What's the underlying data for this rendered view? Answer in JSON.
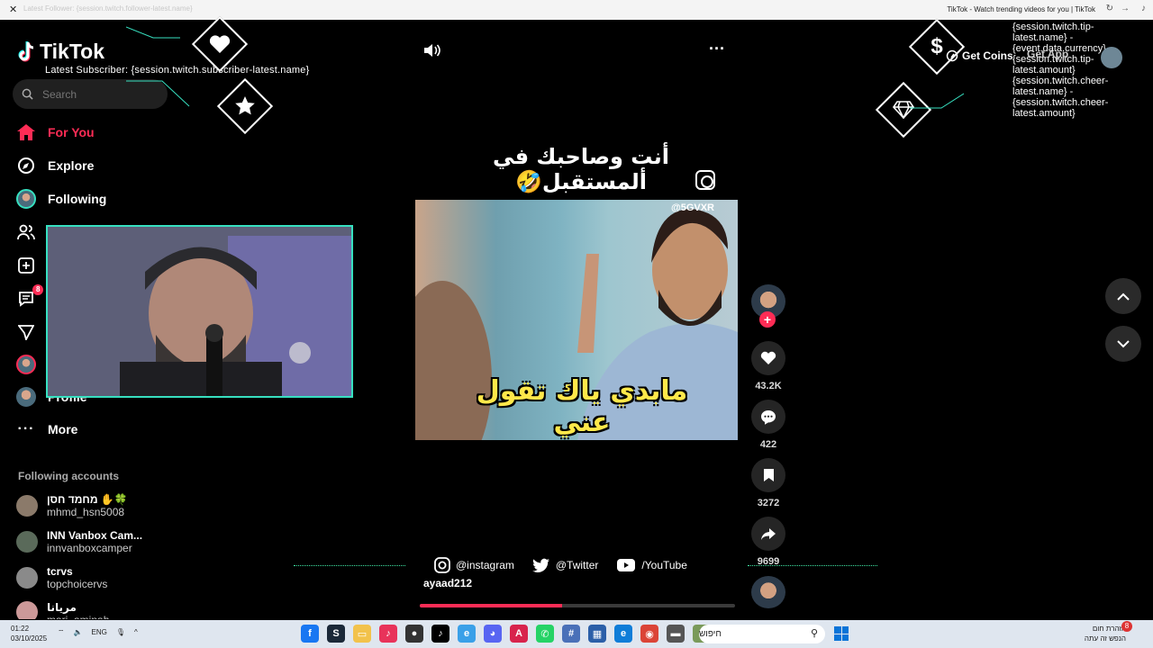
{
  "browser": {
    "url": "Latest Follower: {session.twitch.follower-latest.name}",
    "window_title": "TikTok - Watch trending videos for you | TikTok"
  },
  "sidebar": {
    "logo": "TikTok",
    "search_placeholder": "Search",
    "nav": [
      {
        "label": "For You",
        "icon": "home-icon",
        "active": true
      },
      {
        "label": "Explore",
        "icon": "compass-icon"
      },
      {
        "label": "Following",
        "icon": "avatar-icon"
      },
      {
        "label": "",
        "icon": "friends-icon"
      },
      {
        "label": "",
        "icon": "upload-icon"
      },
      {
        "label": "",
        "icon": "inbox-icon",
        "badge": "8"
      },
      {
        "label": "",
        "icon": "send-icon"
      },
      {
        "label": "",
        "icon": "live-icon"
      },
      {
        "label": "Profile",
        "icon": "profile-icon"
      },
      {
        "label": "More",
        "icon": "more-icon"
      }
    ],
    "following_title": "Following accounts",
    "accounts": [
      {
        "name": "מחמד חסן ✋🍀",
        "handle": "mhmd_hsn5008"
      },
      {
        "name": "INN Vanbox Cam...",
        "handle": "innvanboxcamper"
      },
      {
        "name": "tcrvs",
        "handle": "topchoicervs"
      },
      {
        "name": "مريانا",
        "handle": "mari_aminah"
      }
    ]
  },
  "overlay": {
    "latest_subscriber": "Latest Subscriber: {session.twitch.subscriber-latest.name}",
    "tip_text": "{session.twitch.tip-latest.name} - {event.data.currency}{session.twitch.tip-latest.amount} {session.twitch.cheer-latest.name} - {session.twitch.cheer-latest.amount}"
  },
  "video": {
    "caption": "أنت وصاحبك في ألمستقبل🤣",
    "watermark": "@5GVXR",
    "subtitle": "مابدي ياك تقول عني",
    "author": "ayaad212",
    "progress": 0.45
  },
  "actions": {
    "likes": "43.2K",
    "comments": "422",
    "saves": "3272",
    "shares": "9699"
  },
  "socials": {
    "instagram": "@instagram",
    "twitter": "@Twitter",
    "youtube": "/YouTube"
  },
  "topright": {
    "get_coins": "Get Coins",
    "get_app": "Get App"
  },
  "taskbar": {
    "time": "01:22",
    "date": "03/10/2025",
    "lang": "ENG",
    "search_placeholder": "חיפוש",
    "weather_line1": "אזהרת חום",
    "weather_line2": "הנפש זה עתה",
    "notif_count": "8"
  },
  "colors": {
    "accent": "#fe2c55",
    "overlay_line": "#37e0c0",
    "subtitle": "#ffe84a"
  }
}
